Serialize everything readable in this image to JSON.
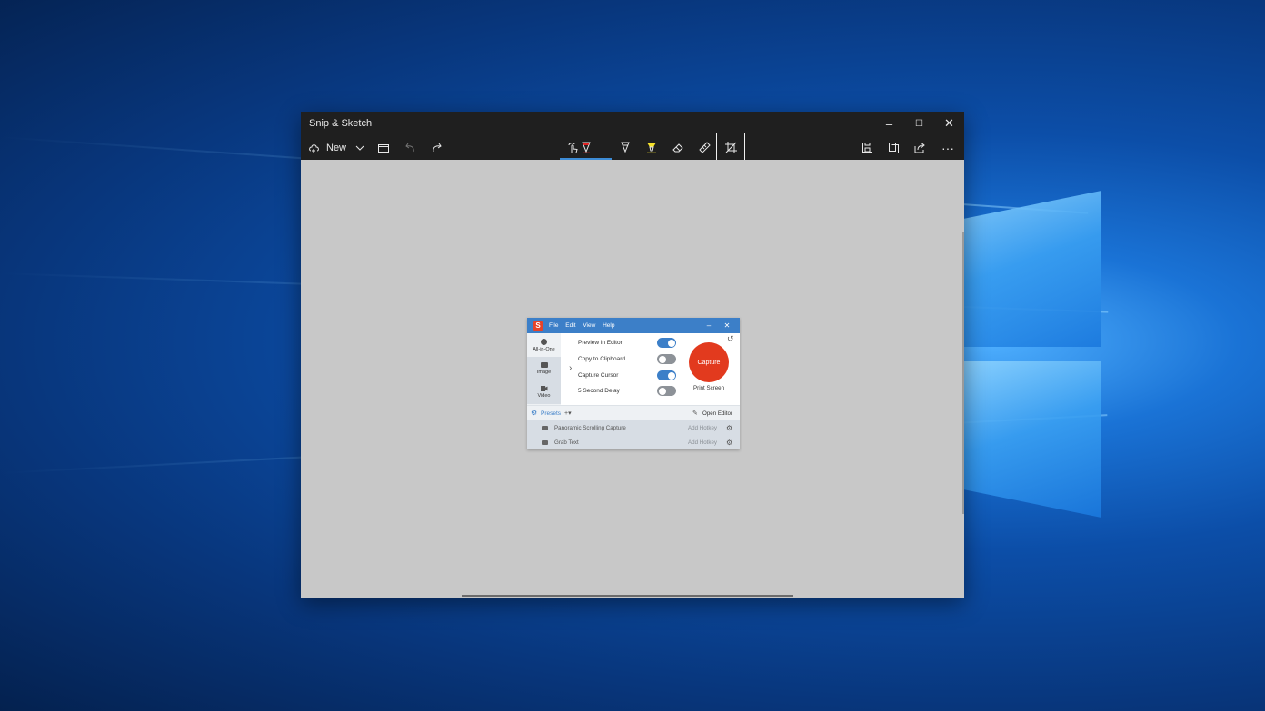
{
  "app": {
    "title": "Snip & Sketch",
    "window_controls": {
      "minimize": "–",
      "maximize": "☐",
      "close": "✕"
    }
  },
  "toolbar": {
    "new_label": "New",
    "icons": [
      "new-snip-icon",
      "chevron-down-icon",
      "folder-icon",
      "undo-icon",
      "redo-icon",
      "touch-writing-icon",
      "ballpoint-pen-icon",
      "pencil-icon",
      "highlighter-icon",
      "eraser-icon",
      "ruler-icon",
      "crop-icon",
      "save-icon",
      "copy-icon",
      "share-icon",
      "more-icon"
    ],
    "active_tool": "ballpoint-pen",
    "selected_tool": "crop"
  },
  "colors": {
    "titlebar": "#1f1f1f",
    "canvas": "#c8c8c8",
    "accent": "#3d8cd6",
    "pen_red": "#e02020",
    "highlighter_yellow": "#f5e12a",
    "snagit_blue": "#3c7fc8",
    "capture_red": "#e23a1e"
  },
  "snagit": {
    "menu": [
      "File",
      "Edit",
      "View",
      "Help"
    ],
    "window_controls": {
      "minimize": "–",
      "close": "✕"
    },
    "sidebar": [
      "All-in-One",
      "Image",
      "Video"
    ],
    "options": [
      {
        "label": "Preview in Editor",
        "on": true
      },
      {
        "label": "Copy to Clipboard",
        "on": false
      },
      {
        "label": "Capture Cursor",
        "on": true
      },
      {
        "label": "5 Second Delay",
        "on": false
      }
    ],
    "capture_label": "Capture",
    "shortcut_label": "Print Screen",
    "presets_label": "Presets",
    "add_preset": "+▾",
    "open_editor": "Open Editor",
    "preset_rows": [
      {
        "name": "Panoramic Scrolling Capture",
        "hotkey": "Add Hotkey"
      },
      {
        "name": "Grab Text",
        "hotkey": "Add Hotkey"
      }
    ]
  }
}
